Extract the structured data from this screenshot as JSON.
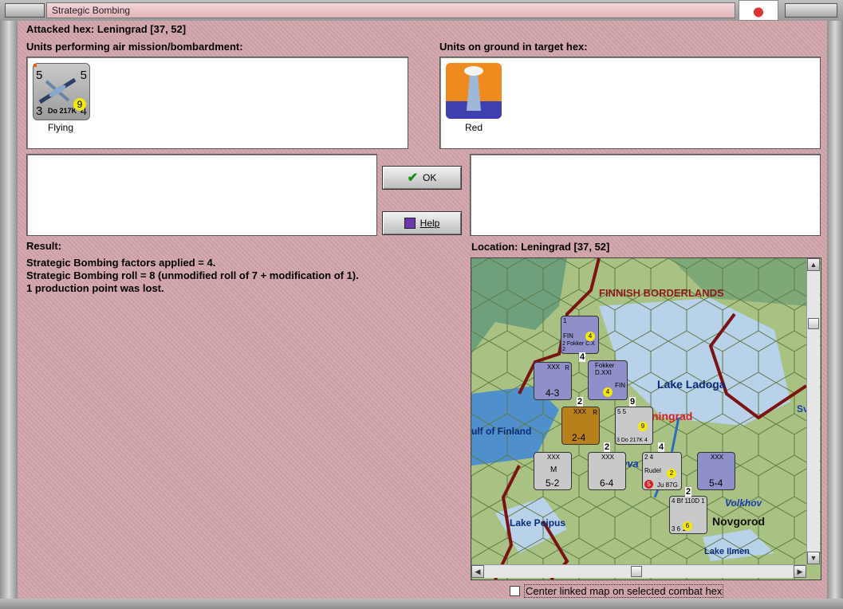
{
  "window": {
    "title": "Strategic Bombing"
  },
  "header": {
    "attacked_hex": "Attacked hex: Leningrad  [37, 52]"
  },
  "air_units": {
    "label": "Units performing air mission/bombardment:",
    "unit": {
      "top_left": "5",
      "top_right": "5",
      "bottom_left": "3",
      "bottom_right": "4",
      "name": "Do 217K",
      "badge": "9",
      "caption": "Flying"
    }
  },
  "ground_units": {
    "label": "Units on ground in target hex:",
    "unit": {
      "caption": "Red"
    }
  },
  "buttons": {
    "ok": "OK",
    "help": "Help"
  },
  "result": {
    "label": "Result:",
    "lines": [
      "Strategic Bombing factors applied = 4.",
      "Strategic Bombing roll = 8 (unmodified roll of 7 + modification of 1).",
      "1 production point was lost."
    ]
  },
  "location": {
    "label": "Location:  Leningrad  [37, 52]"
  },
  "map": {
    "labels": {
      "region": "FINNISH BORDERLANDS",
      "lake_ladoga": "Lake Ladoga",
      "leningrad": "ningrad",
      "gulf": "ulf of Finland",
      "lake_peipus": "Lake Peipus",
      "volkhov": "Volkhov",
      "novgorod": "Novgorod",
      "lake_ilmen": "Lake Ilmen",
      "neva": "eva",
      "edge": "Sv"
    },
    "counters": [
      {
        "id": "fokker-cx",
        "top": "1",
        "mid": "FIN",
        "bottom": "2 Fokker C.X 2",
        "badge": "4"
      },
      {
        "id": "inf-4-3",
        "top": "XXX",
        "bottom": "4-3",
        "side": "R"
      },
      {
        "id": "fokker-dxxi",
        "top": "Fokker D.XXI",
        "mid": "FIN",
        "badge": "4"
      },
      {
        "id": "armor-2-4",
        "top": "XXX",
        "bottom": "2-4",
        "side": "R"
      },
      {
        "id": "do217k",
        "top": "5 5",
        "bottom": "3 Do 217K 4",
        "badge": "9"
      },
      {
        "id": "inf-5-2",
        "top": "XXX",
        "bottom": "5-2",
        "side": "M"
      },
      {
        "id": "inf-6-4",
        "top": "XXX",
        "bottom": "6-4"
      },
      {
        "id": "ju87g",
        "top": "2 4",
        "name": "Rudel",
        "bottom": "Ju 87G",
        "badge": "2",
        "red_badge": "5"
      },
      {
        "id": "inf-5-4",
        "top": "XXX",
        "bottom": "5-4"
      },
      {
        "id": "bf110d",
        "top": "4 Bf 110D 1",
        "bottom": "3 6 1",
        "badge": "6"
      }
    ],
    "stack_numbers": [
      "4",
      "2",
      "9",
      "2",
      "4",
      "2"
    ]
  },
  "footer": {
    "center_map_label": "Center linked map on selected combat hex"
  },
  "colors": {
    "dialog_bg": "#d2a5ab",
    "map_land": "#9fb979",
    "map_water": "#b8d2ea",
    "border_red": "#7b1313",
    "city_red": "#d62020"
  }
}
